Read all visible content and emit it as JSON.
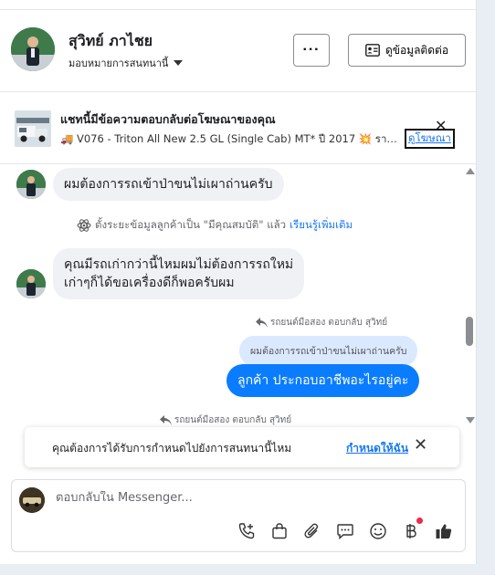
{
  "header": {
    "contact_name": "สุวิทย์ ภาไชย",
    "assignee_label": "มอบหมายการสนทนานี้",
    "more_label": "···",
    "contact_info_label": "ดูข้อมูลติดต่อ"
  },
  "ad_banner": {
    "title": "แชทนี้มีข้อความตอบกลับต่อโฆษณาของคุณ",
    "description": "🚚 V076 - Triton All New 2.5 GL (Single Cab) MT* ปี 2017 💥 ราคา...",
    "view_ad_label": "ดูโฆษณา",
    "close_label": "✕"
  },
  "messages": {
    "m1": "ผมต้องการรถเข้าป่าขนไม่เผาถ่านครับ",
    "system_text": "ตั้งระยะข้อมูลลูกค้าเป็น \"มีคุณสมบัติ\" แล้ว",
    "system_link": "เรียนรู้เพิ่มเติม",
    "m2_line1": "คุณมีรถเก่ากว่านี้ไหมผมไม่ต้องการรถใหม่",
    "m2_line2": "เก่าๆก็ได้ขอเครื่องดีก็พอครับผม",
    "reply_tag_1": "รถยนต์มือสอง ตอบกลับ สุวิทย์",
    "quoted_1": "ผมต้องการรถเข้าป่าขนไม่เผาถ่านครับ",
    "outgoing_1": "ลูกค้า  ประกอบอาชีพอะไรอยู่คะ",
    "reply_tag_2": "รถยนต์มือสอง ตอบกลับ สุวิทย์"
  },
  "toast": {
    "text": "คุณต้องการได้รับการกำหนดไปยังการสนทนานี้ไหม",
    "link": "กำหนดให้ฉัน",
    "close_label": "✕"
  },
  "composer": {
    "placeholder": "ตอบกลับใน Messenger...",
    "tools": [
      "phone-add-icon",
      "shopping-bag-icon",
      "paperclip-icon",
      "chat-bubble-icon",
      "emoji-icon",
      "baht-icon",
      "thumbs-up-icon"
    ]
  },
  "colors": {
    "accent": "#0a7cff",
    "link": "#1877f2",
    "incoming_bubble": "#eff1f4",
    "quoted_bubble": "#dbe9ff",
    "notification_dot": "#f0284a"
  }
}
